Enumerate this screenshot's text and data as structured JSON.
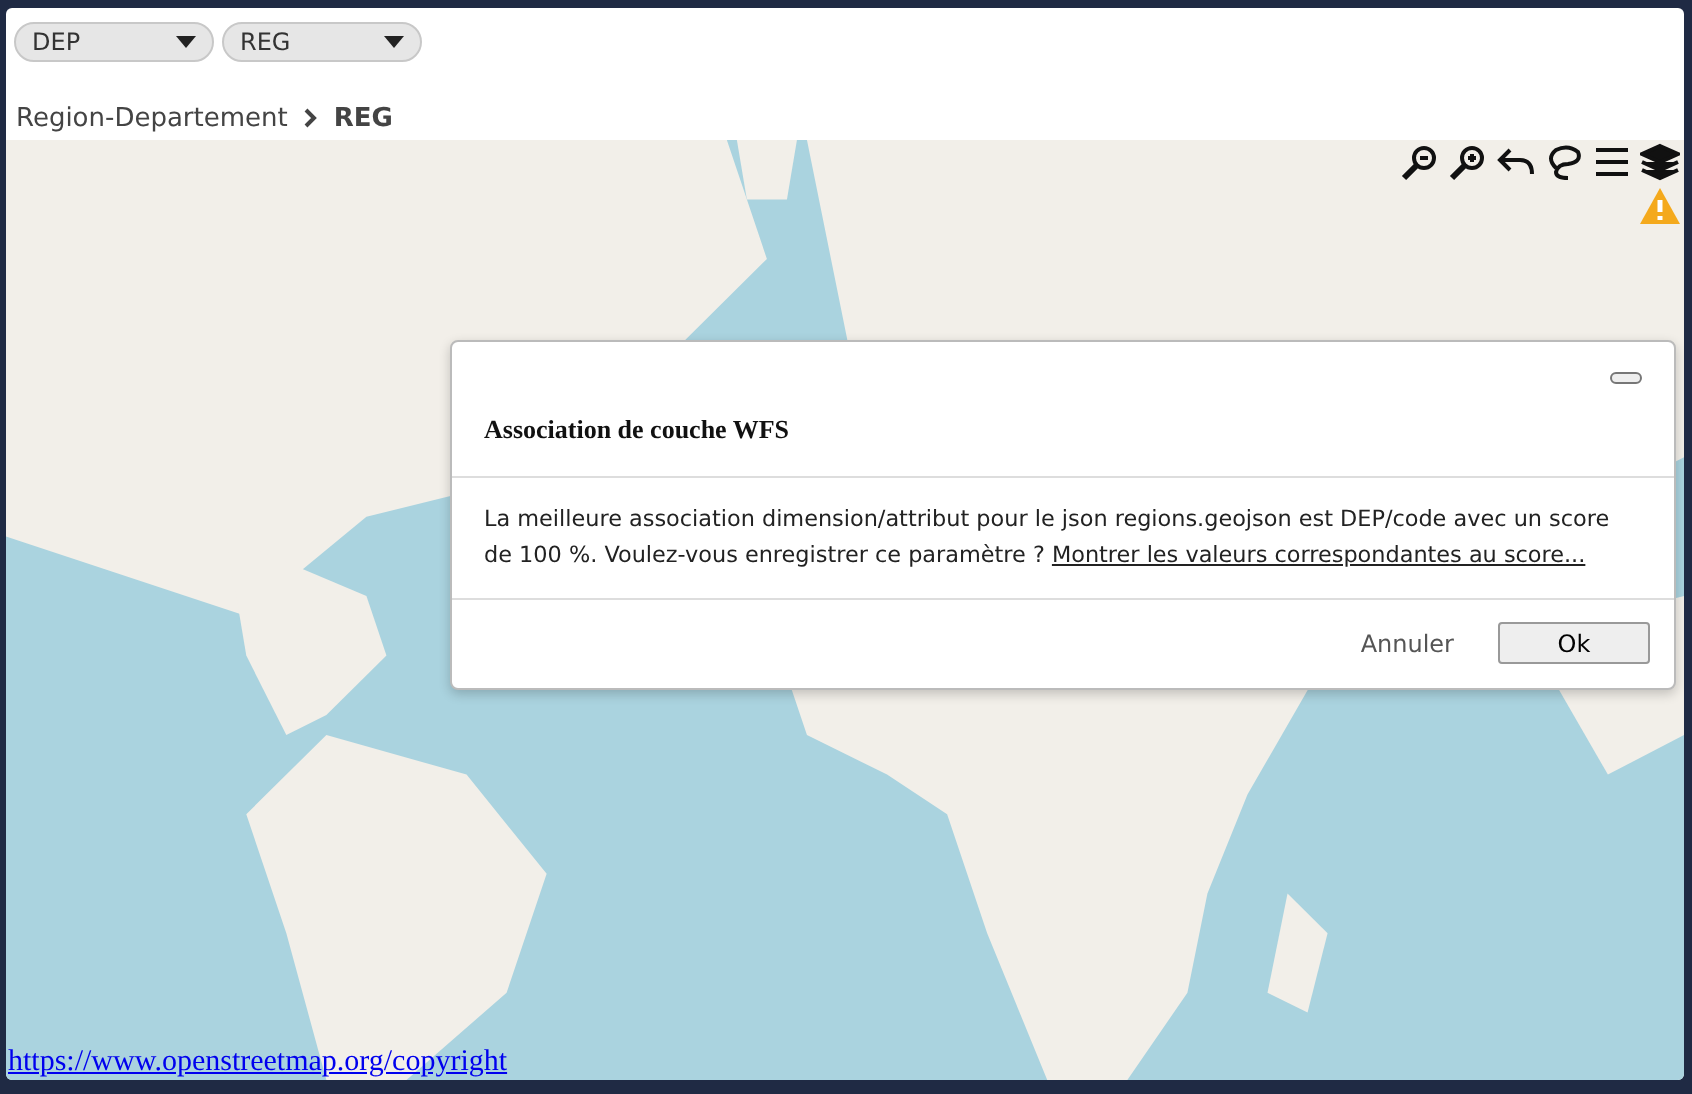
{
  "selects": [
    {
      "value": "DEP"
    },
    {
      "value": "REG"
    }
  ],
  "breadcrumb": {
    "parent": "Region-Departement",
    "current": "REG"
  },
  "map": {
    "kind": "picture",
    "attribution": "https://www.openstreetmap.org/copyright",
    "tools": [
      {
        "kind": "zoom-out"
      },
      {
        "kind": "zoom-in"
      },
      {
        "kind": "undo"
      },
      {
        "kind": "lasso"
      },
      {
        "kind": "menu"
      },
      {
        "kind": "layers"
      }
    ],
    "warning": true
  },
  "dialog": {
    "title": "Association de couche WFS",
    "message": "La meilleure association dimension/attribut pour le json regions.geojson est DEP/code avec un score de 100 %. Voulez-vous enregistrer ce paramètre ?",
    "link": "Montrer les valeurs correspondantes au score...",
    "cancel": "Annuler",
    "ok": "Ok"
  }
}
